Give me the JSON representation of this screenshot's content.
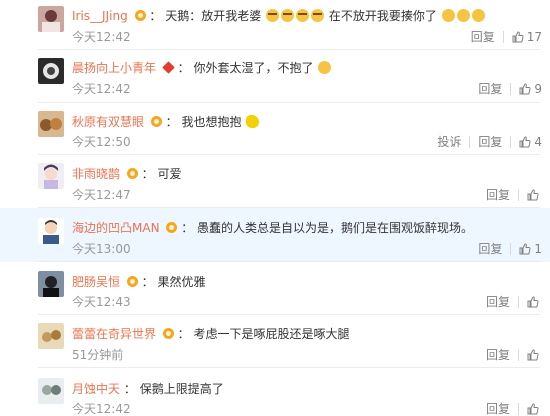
{
  "comments": [
    {
      "username": "Iris__JJing",
      "badge": "yellow",
      "separator": "：",
      "text": "天鹅：放开我老婆",
      "emoji_after_1": "cry",
      "text2": "在不放开我要揍你了",
      "time": "今天12:42",
      "reply": "回复",
      "likes": "17",
      "report": ""
    },
    {
      "username": "晨扬向上小青年",
      "badge": "red",
      "separator": "：",
      "text": "你外套太湿了，不抱了",
      "time": "今天12:42",
      "reply": "回复",
      "likes": "9",
      "report": ""
    },
    {
      "username": "秋原有双慧眼",
      "badge": "yellow",
      "separator": "：",
      "text": "我也想抱抱",
      "time": "今天12:50",
      "reply": "回复",
      "likes": "4",
      "report": "投诉"
    },
    {
      "username": "非雨晓鹊",
      "badge": "yellow",
      "separator": "：",
      "text": "可爱",
      "time": "今天12:47",
      "reply": "回复",
      "likes": "",
      "report": ""
    },
    {
      "username": "海边的凹凸MAN",
      "badge": "yellow",
      "separator": "：",
      "text": "愚蠢的人类总是自以为是，鹅们是在围观饭醉现场。",
      "time": "今天13:00",
      "reply": "回复",
      "likes": "1",
      "report": ""
    },
    {
      "username": "肥肠吴恒",
      "badge": "yellow",
      "separator": "：",
      "text": "果然优雅",
      "time": "今天12:43",
      "reply": "回复",
      "likes": "",
      "report": ""
    },
    {
      "username": "蕾蕾在奇异世界",
      "badge": "yellow",
      "separator": "：",
      "text": "考虑一下是啄屁股还是啄大腿",
      "time": "51分钟前",
      "reply": "回复",
      "likes": "",
      "report": ""
    },
    {
      "username": "月蚀中天",
      "badge": "",
      "separator": "：",
      "text": "保鹅上限提高了",
      "time": "今天12:42",
      "reply": "回复",
      "likes": "",
      "report": ""
    }
  ],
  "colors": {
    "username": "#eb7350",
    "timestamp": "#999999",
    "action": "#808080",
    "highlight": "#eef6ff"
  },
  "icons": {
    "like": "thumbs-up-icon",
    "badge": "member-badge-icon"
  }
}
